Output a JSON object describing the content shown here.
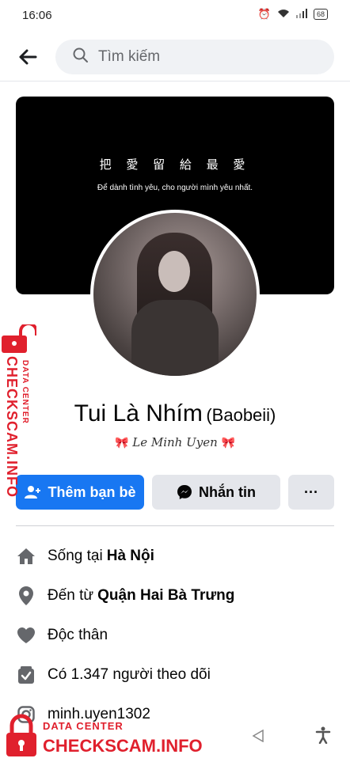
{
  "status_bar": {
    "time": "16:06",
    "battery": "68"
  },
  "search": {
    "placeholder": "Tìm kiếm"
  },
  "cover": {
    "line1": "把 愛 留 給 最 愛",
    "line2": "Để dành tình yêu, cho người mình yêu nhất."
  },
  "profile": {
    "name": "Tui Là Nhím",
    "alternate_name": "(Baobeii)",
    "nickname": "Le Minh Uyen"
  },
  "buttons": {
    "add_friend": "Thêm bạn bè",
    "message": "Nhắn tin",
    "more": "···"
  },
  "info": {
    "lives_in_prefix": "Sống tại",
    "lives_in_value": "Hà Nội",
    "from_prefix": "Đến từ",
    "from_value": "Quận Hai Bà Trưng",
    "relationship": "Độc thân",
    "followers": "Có 1.347 người theo dõi",
    "instagram": "minh.uyen1302"
  },
  "watermark": {
    "data_center": "DATA CENTER",
    "brand": "CHECKSCAM.INFO"
  },
  "colors": {
    "accent": "#1877f2",
    "watermark": "#e0202d"
  }
}
